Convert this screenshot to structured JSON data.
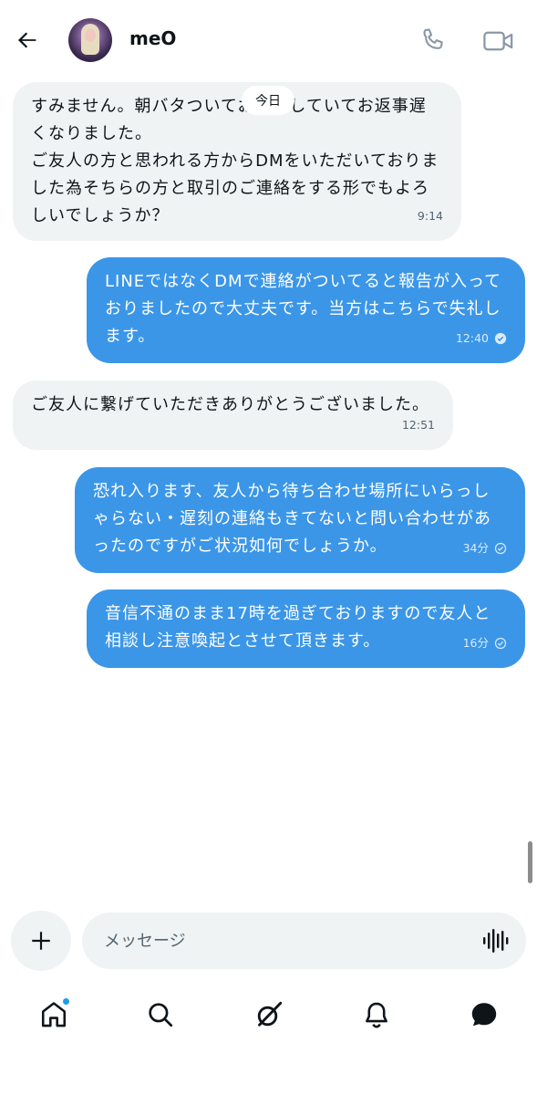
{
  "header": {
    "title": "meO",
    "back_icon": "arrow-left-icon",
    "call_icon": "phone-icon",
    "video_icon": "video-camera-icon"
  },
  "thread": {
    "date_chip": "今日",
    "messages": [
      {
        "direction": "incoming",
        "text": "すみません。朝バタついておりましていてお返事遅くなりました。\nご友人の方と思われる方からDMをいただいておりました為そちらの方と取引のご連絡をする形でもよろしいでしょうか？",
        "time": "9:14"
      },
      {
        "direction": "outgoing",
        "text": "LINEではなくDMで連絡がついてると報告が入っておりましたので大丈夫です。当方はこちらで失礼します。",
        "time": "12:40",
        "status": "read"
      },
      {
        "direction": "incoming",
        "text": "ご友人に繋げていただきありがとうございました。",
        "time": "12:51"
      },
      {
        "direction": "outgoing",
        "text": "恐れ入ります、友人から待ち合わせ場所にいらっしゃらない・遅刻の連絡もきてないと問い合わせがあったのですがご状況如何でしょうか。",
        "time": "34分",
        "status": "sent"
      },
      {
        "direction": "outgoing",
        "text": "音信不通のまま17時を過ぎておりますので友人と相談し注意喚起とさせて頂きます。",
        "time": "16分",
        "status": "sent"
      }
    ]
  },
  "composer": {
    "add_icon": "plus-icon",
    "placeholder": "メッセージ",
    "value": "",
    "voice_icon": "voice-waveform-icon"
  },
  "tabbar": {
    "items": [
      {
        "name": "home",
        "icon": "home-icon",
        "has_badge": true
      },
      {
        "name": "search",
        "icon": "search-icon",
        "has_badge": false
      },
      {
        "name": "grok",
        "icon": "grok-icon",
        "has_badge": false
      },
      {
        "name": "notifications",
        "icon": "bell-icon",
        "has_badge": false
      },
      {
        "name": "messages",
        "icon": "message-bubble-icon",
        "has_badge": false,
        "active": true
      }
    ]
  },
  "colors": {
    "outgoing_bubble": "#3b96e8",
    "incoming_bubble": "#eff3f4",
    "accent": "#1d9bf0",
    "text": "#0f1419"
  }
}
